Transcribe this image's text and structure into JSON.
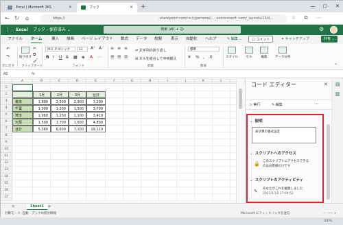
{
  "browser": {
    "tabs": [
      {
        "label": "Excel | Microsoft 365"
      },
      {
        "label": "ブック"
      }
    ],
    "url_left": "https://",
    "url_right": ".sharepoint.com/:x:/r/personal/..._onmicrosoft_com/_layouts/15/d..."
  },
  "app": {
    "name": "Excel",
    "doc_title": "ブック - 保存済み ⌄",
    "search_placeholder": "検索 (Alt + Q)"
  },
  "ribbon_tabs": [
    "ファイル",
    "ホーム",
    "挿入",
    "描画",
    "ページ レイアウト",
    "数式",
    "データ",
    "校閲",
    "表示",
    "自動化",
    "ヘルプ"
  ],
  "ribbon_actions": {
    "edit": "✎ 編集 ⌄",
    "comment": "□ コメント",
    "catch_up": "✦ キャッチアップ",
    "share": "共有 ⌄"
  },
  "ribbon": {
    "undo_label": "元に戻す",
    "paste_label": "貼り付け",
    "clipboard_label": "クリップボード",
    "font_name": "ＭＳ Ｐゴシック",
    "font_size": "11",
    "font_label": "フォント",
    "wrap_text": "文字列の折り返し",
    "merge_center": "セルを結合して中央揃え",
    "alignment_label": "配置",
    "number_format": "標準",
    "number_label": "数値",
    "styles_label": "スタイル",
    "cells_label": "セル",
    "editing_label": "編集",
    "analyze_label": "データ分析"
  },
  "formula_bar": {
    "name_box": "A1",
    "fx": "fx"
  },
  "sheet": {
    "columns": [
      "A",
      "B",
      "C",
      "D",
      "E",
      "F",
      "G",
      "H",
      "I",
      "J",
      "K",
      "L",
      "M",
      "N"
    ],
    "rows": [
      "1",
      "2",
      "3",
      "4",
      "5",
      "6",
      "7",
      "8",
      "9",
      "10",
      "11",
      "12",
      "13",
      "14",
      "15",
      "16",
      "17"
    ],
    "header": [
      "",
      "1月",
      "2月",
      "3月",
      "合計"
    ],
    "data": [
      [
        "東京",
        "1,800",
        "2,500",
        "2,900",
        "7,200"
      ],
      [
        "千葉",
        "1,000",
        "1,200",
        "1,500",
        "3,700"
      ],
      [
        "埼玉",
        "1,080",
        "1,230",
        "1,100",
        "3,410"
      ],
      [
        "大阪",
        "1,500",
        "1,700",
        "1,600",
        "4,800"
      ],
      [
        "合計",
        "5,380",
        "6,630",
        "7,100",
        "19,110"
      ]
    ],
    "tab_name": "Sheet1"
  },
  "code_editor": {
    "title": "コード エディター",
    "run": "▷ 実行",
    "edit": "✎ 編集",
    "more": "···",
    "description_header": "説明",
    "description_value": "表計算の書式設定",
    "access_header": "スクリプトへのアクセス",
    "access_text_1": "このスクリプトにアクセスできる",
    "access_text_2": "のはお客様だけです",
    "activity_header": "スクリプトのアクティビティ",
    "activity_text": "あなたがこれを編集しました",
    "activity_time": "2023/1/18 17:09:52"
  },
  "status_bar": {
    "left": "計算モード: 自動　ブックの統計情報",
    "right": "Microsoft にフィードバックを送信",
    "zoom": "— ─── + 100%"
  }
}
